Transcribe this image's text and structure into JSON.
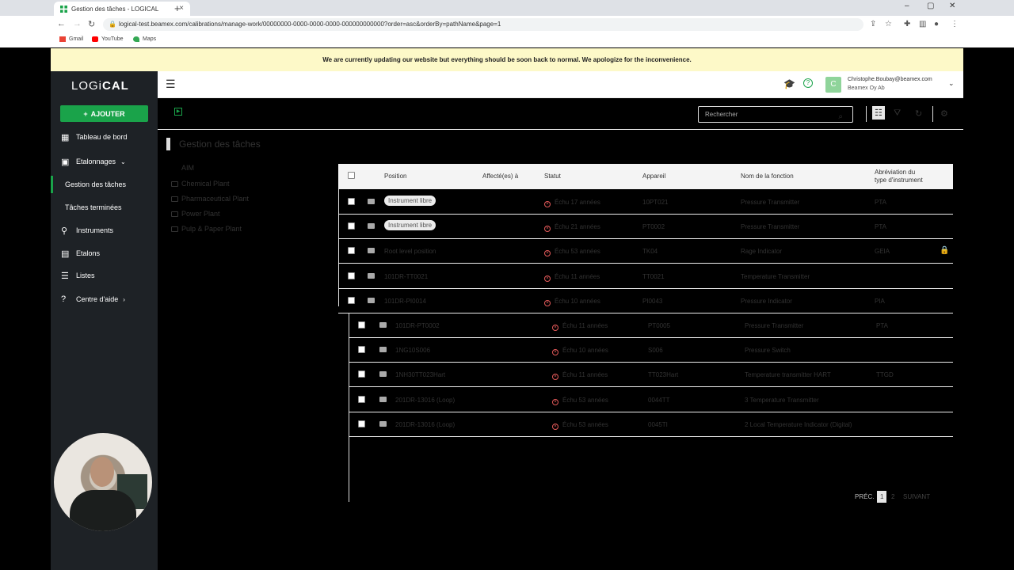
{
  "browser": {
    "tab_title": "Gestion des tâches - LOGICAL",
    "url": "logical-test.beamex.com/calibrations/manage-work/00000000-0000-0000-0000-000000000000?order=asc&orderBy=pathName&page=1",
    "bookmarks": [
      "Gmail",
      "YouTube",
      "Maps"
    ]
  },
  "banner": "We are currently updating our website but everything should be soon back to normal. We apologize for the inconvenience.",
  "sidebar": {
    "logo_a": "LOGi",
    "logo_b": "CAL",
    "add_label": "AJOUTER",
    "items": [
      {
        "label": "Tableau de bord"
      },
      {
        "label": "Etalonnages"
      },
      {
        "label": "Gestion des tâches"
      },
      {
        "label": "Tâches terminées"
      },
      {
        "label": "Instruments"
      },
      {
        "label": "Etalons"
      },
      {
        "label": "Listes"
      },
      {
        "label": "Centre d'aide"
      }
    ]
  },
  "header": {
    "user_initial": "C",
    "user_email": "Christophe.Boubay@beamex.com",
    "user_org": "Beamex Oy Ab"
  },
  "toolbar": {
    "search_placeholder": "Rechercher"
  },
  "page_title": "Gestion des tâches",
  "tree": {
    "root": "AIM",
    "items": [
      "Chemical Plant",
      "Pharmaceutical Plant",
      "Power Plant",
      "Pulp & Paper Plant"
    ]
  },
  "table": {
    "headers": {
      "position": "Position",
      "assigned": "Affecté(es) à",
      "status": "Statut",
      "device": "Appareil",
      "function": "Nom de la fonction",
      "abbr_line1": "Abréviation du",
      "abbr_line2": "type d'instrument"
    },
    "rows": [
      {
        "position": "Instrument libre",
        "badge": true,
        "status": "Échu 17 années",
        "device": "10PT021",
        "function": "Pressure Transmitter",
        "abbr": "PTA",
        "locked": false
      },
      {
        "position": "Instrument libre",
        "badge": true,
        "status": "Échu 21 années",
        "device": "PT0002",
        "function": "Pressure Transmitter",
        "abbr": "PTA",
        "locked": false
      },
      {
        "position": "Root level position",
        "badge": false,
        "status": "Échu 53 années",
        "device": "TK04",
        "function": "Rage Indicator",
        "abbr": "GEIA",
        "locked": true
      },
      {
        "position": "101DR-TT0021",
        "badge": false,
        "status": "Échu 11 années",
        "device": "TT0021",
        "function": "Temperature Transmitter",
        "abbr": "",
        "locked": false
      },
      {
        "position": "101DR-PI0014",
        "badge": false,
        "status": "Échu 10 années",
        "device": "PI0043",
        "function": "Pressure Indicator",
        "abbr": "PIA",
        "locked": false
      },
      {
        "position": "101DR-PT0002",
        "badge": false,
        "status": "Échu 11 années",
        "device": "PT0005",
        "function": "Pressure Transmitter",
        "abbr": "PTA",
        "locked": false
      },
      {
        "position": "1NG10S006",
        "badge": false,
        "status": "Échu 10 années",
        "device": "S006",
        "function": "Pressure Switch",
        "abbr": "",
        "locked": false
      },
      {
        "position": "1NH30TT023Hart",
        "badge": false,
        "status": "Échu 11 années",
        "device": "TT023Hart",
        "function": "Temperature transmitter HART",
        "abbr": "TTGD",
        "locked": false
      },
      {
        "position": "201DR-13016 (Loop)",
        "badge": false,
        "status": "Échu 53 années",
        "device": "0044TT",
        "function": "3 Temperature Transmitter",
        "abbr": "",
        "locked": false
      },
      {
        "position": "201DR-13016 (Loop)",
        "badge": false,
        "status": "Échu 53 années",
        "device": "0045TI",
        "function": "2 Local Temperature Indicator (Digital)",
        "abbr": "",
        "locked": false
      }
    ]
  },
  "pagination": {
    "prev": "PRÉC.",
    "pages": [
      "1",
      "2"
    ],
    "next": "SUIVANT"
  },
  "colors": {
    "brand_green": "#1aa34a",
    "sidebar_bg": "#1e2226",
    "banner_bg": "#fdf9c8",
    "status_red": "#e45a5a"
  }
}
